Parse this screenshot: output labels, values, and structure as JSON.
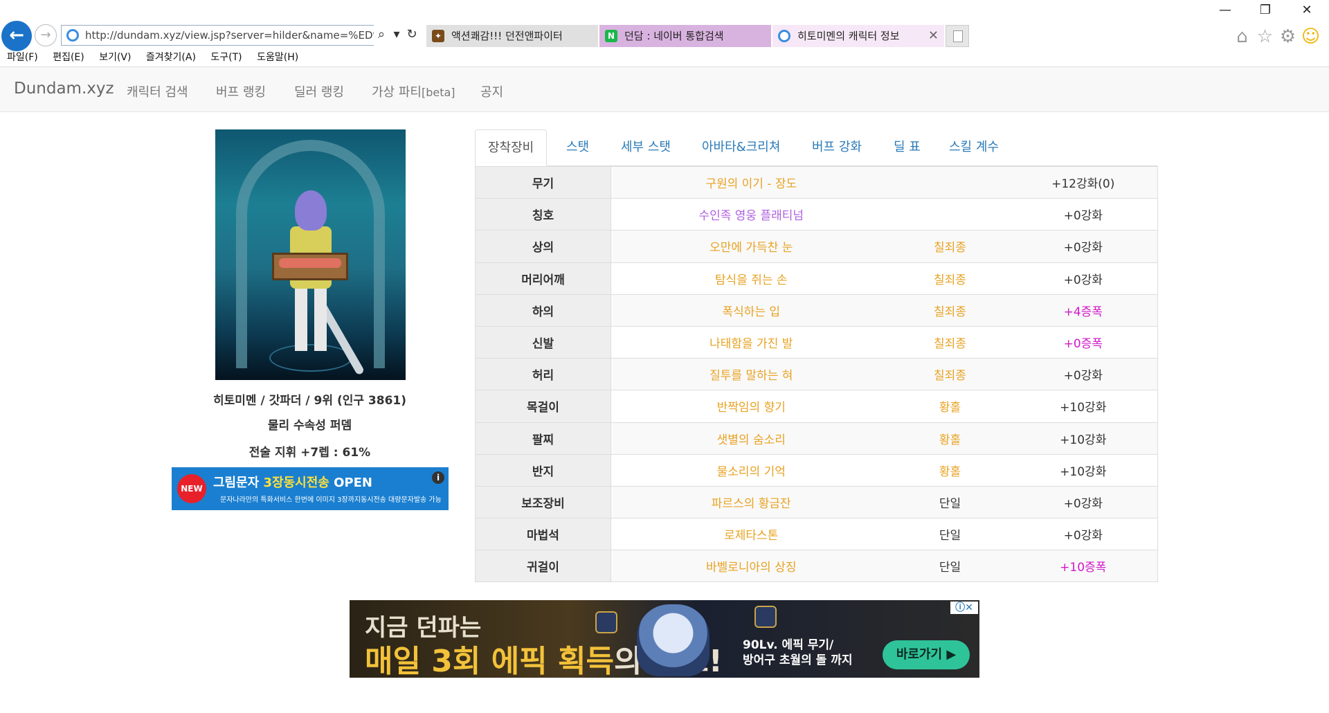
{
  "browser": {
    "url": "http://dundam.xyz/view.jsp?server=hilder&name=%ED%9E%",
    "tabs": [
      {
        "label": "액션쾌감!!! 던전앤파이터"
      },
      {
        "label": "던담 : 네이버 통합검색"
      },
      {
        "label": "히토미멘의 캐릭터 정보"
      }
    ],
    "menu": [
      "파일(F)",
      "편집(E)",
      "보기(V)",
      "즐겨찾기(A)",
      "도구(T)",
      "도움말(H)"
    ]
  },
  "site": {
    "brand": "Dundam.xyz",
    "nav": [
      "캐릭터 검색",
      "버프 랭킹",
      "딜러 랭킹",
      "가상 파티",
      "[beta]",
      "공지"
    ]
  },
  "profile": {
    "line1": "히토미멘 / 갓파더 / 9위 (인구 3861)",
    "line2": "물리 수속성 퍼뎀",
    "line3": "전술 지휘 +7렙 : 61%"
  },
  "ad_small": {
    "badge": "NEW",
    "title_a": "그림문자 ",
    "title_b": "3장동시전송",
    "title_c": " OPEN",
    "sub": "문자나라만의 특화서비스 한번에 이미지 3장까지동시전송 대량문자발송 가능",
    "info": "i"
  },
  "panel_tabs": [
    "장착장비",
    "스탯",
    "세부 스탯",
    "아바타&크리쳐",
    "버프 강화",
    "딜 표",
    "스킬 계수"
  ],
  "equipment": [
    {
      "slot": "무기",
      "name": "구원의 이기 - 장도",
      "set": "",
      "enh": "+12강화(0)",
      "name_color": "epic",
      "enh_color": "normal"
    },
    {
      "slot": "칭호",
      "name": "수인족 영웅 플래티넘",
      "set": "",
      "enh": "+0강화",
      "name_color": "unique",
      "enh_color": "normal"
    },
    {
      "slot": "상의",
      "name": "오만에 가득찬 눈",
      "set": "칠죄종",
      "enh": "+0강화",
      "name_color": "epic",
      "enh_color": "normal"
    },
    {
      "slot": "머리어깨",
      "name": "탐식을 쥐는 손",
      "set": "칠죄종",
      "enh": "+0강화",
      "name_color": "epic",
      "enh_color": "normal"
    },
    {
      "slot": "하의",
      "name": "폭식하는 입",
      "set": "칠죄종",
      "enh": "+4증폭",
      "name_color": "epic",
      "enh_color": "amp"
    },
    {
      "slot": "신발",
      "name": "나태함을 가진 발",
      "set": "칠죄종",
      "enh": "+0증폭",
      "name_color": "epic",
      "enh_color": "amp"
    },
    {
      "slot": "허리",
      "name": "질투를 말하는 혀",
      "set": "칠죄종",
      "enh": "+0강화",
      "name_color": "epic",
      "enh_color": "normal"
    },
    {
      "slot": "목걸이",
      "name": "반짝임의 향기",
      "set": "황홀",
      "enh": "+10강화",
      "name_color": "epic",
      "enh_color": "normal"
    },
    {
      "slot": "팔찌",
      "name": "샛별의 숨소리",
      "set": "황홀",
      "enh": "+10강화",
      "name_color": "epic",
      "enh_color": "normal"
    },
    {
      "slot": "반지",
      "name": "물소리의 기억",
      "set": "황홀",
      "enh": "+10강화",
      "name_color": "epic",
      "enh_color": "normal"
    },
    {
      "slot": "보조장비",
      "name": "파르스의 황금잔",
      "set": "단일",
      "enh": "+0강화",
      "name_color": "epic",
      "enh_color": "normal"
    },
    {
      "slot": "마법석",
      "name": "로제타스톤",
      "set": "단일",
      "enh": "+0강화",
      "name_color": "epic",
      "enh_color": "normal"
    },
    {
      "slot": "귀걸이",
      "name": "바벨로니아의 상징",
      "set": "단일",
      "enh": "+10증폭",
      "name_color": "epic",
      "enh_color": "amp"
    }
  ],
  "colors": {
    "epic": "#e8a222",
    "unique": "#b15fe0",
    "amp": "#d018c8",
    "set": "#e8a222",
    "single": "#333333"
  },
  "ad_bottom": {
    "line1": "지금 던파는",
    "line2a": "매일 3회 에픽 획득",
    "line2b": "의 찬스!",
    "right_text_1": "90Lv. 에픽 무기/",
    "right_text_2": "방어구 초월의 돌",
    "right_text_3": "까지",
    "button": "바로가기 ▶",
    "close": "ⓘ✕"
  }
}
